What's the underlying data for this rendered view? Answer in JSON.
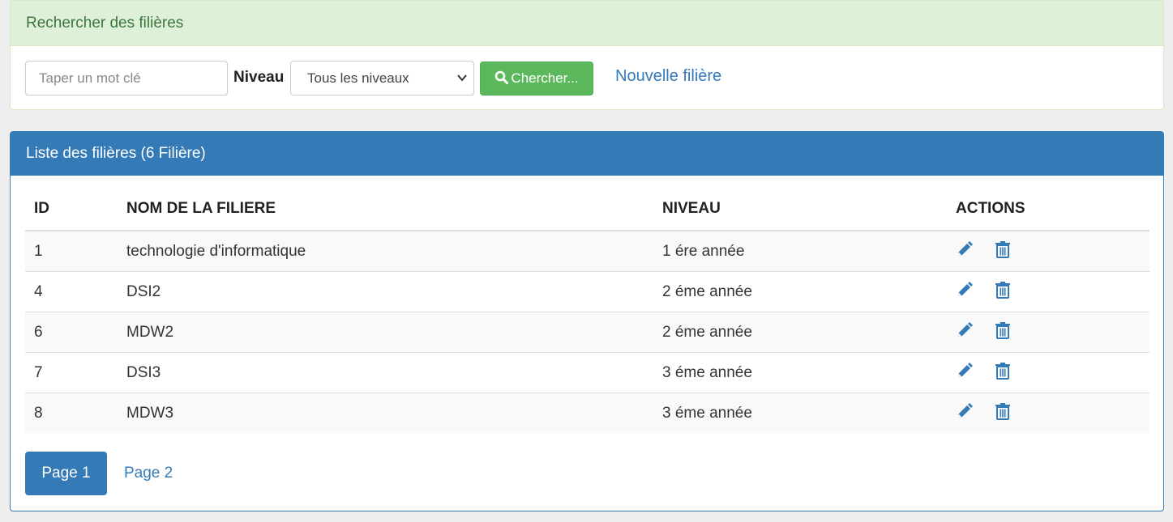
{
  "search": {
    "heading": "Rechercher des filières",
    "keyword_placeholder": "Taper un mot clé",
    "niveau_label": "Niveau",
    "niveau_selected": "Tous les niveaux",
    "search_button": "Chercher...",
    "new_link": "Nouvelle filière"
  },
  "list": {
    "heading": "Liste des filières (6  Filière)",
    "columns": [
      "ID",
      "NOM DE LA FILIERE",
      "NIVEAU",
      "ACTIONS"
    ],
    "rows": [
      {
        "id": "1",
        "nom": "technologie d'informatique",
        "niveau": "1 ére année"
      },
      {
        "id": "4",
        "nom": "DSI2",
        "niveau": "2 éme année"
      },
      {
        "id": "6",
        "nom": "MDW2",
        "niveau": "2 éme année"
      },
      {
        "id": "7",
        "nom": "DSI3",
        "niveau": "3 éme année"
      },
      {
        "id": "8",
        "nom": "MDW3",
        "niveau": "3 éme année"
      }
    ]
  },
  "pagination": {
    "pages": [
      "Page 1",
      "Page 2"
    ]
  },
  "colors": {
    "primary": "#337ab7",
    "success": "#5cb85c",
    "success_bg": "#dff0d8",
    "success_text": "#3c763d"
  },
  "icons": {
    "search": "search-icon",
    "edit": "pencil-icon",
    "delete": "trash-icon",
    "dropdown": "chevron-down-icon"
  }
}
